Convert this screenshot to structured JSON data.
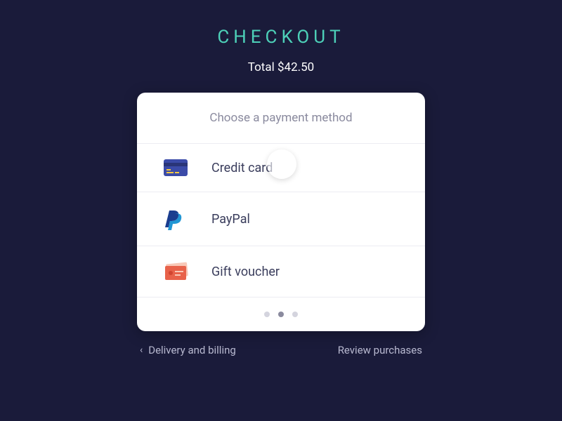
{
  "header": {
    "title": "CHECKOUT",
    "total": "Total $42.50"
  },
  "card": {
    "prompt": "Choose a payment method",
    "options": [
      {
        "label": "Credit card",
        "icon": "credit-card"
      },
      {
        "label": "PayPal",
        "icon": "paypal"
      },
      {
        "label": "Gift voucher",
        "icon": "gift-voucher"
      }
    ],
    "pagination": {
      "count": 3,
      "active": 1
    }
  },
  "footer": {
    "back": "Delivery and billing",
    "forward": "Review purchases"
  }
}
